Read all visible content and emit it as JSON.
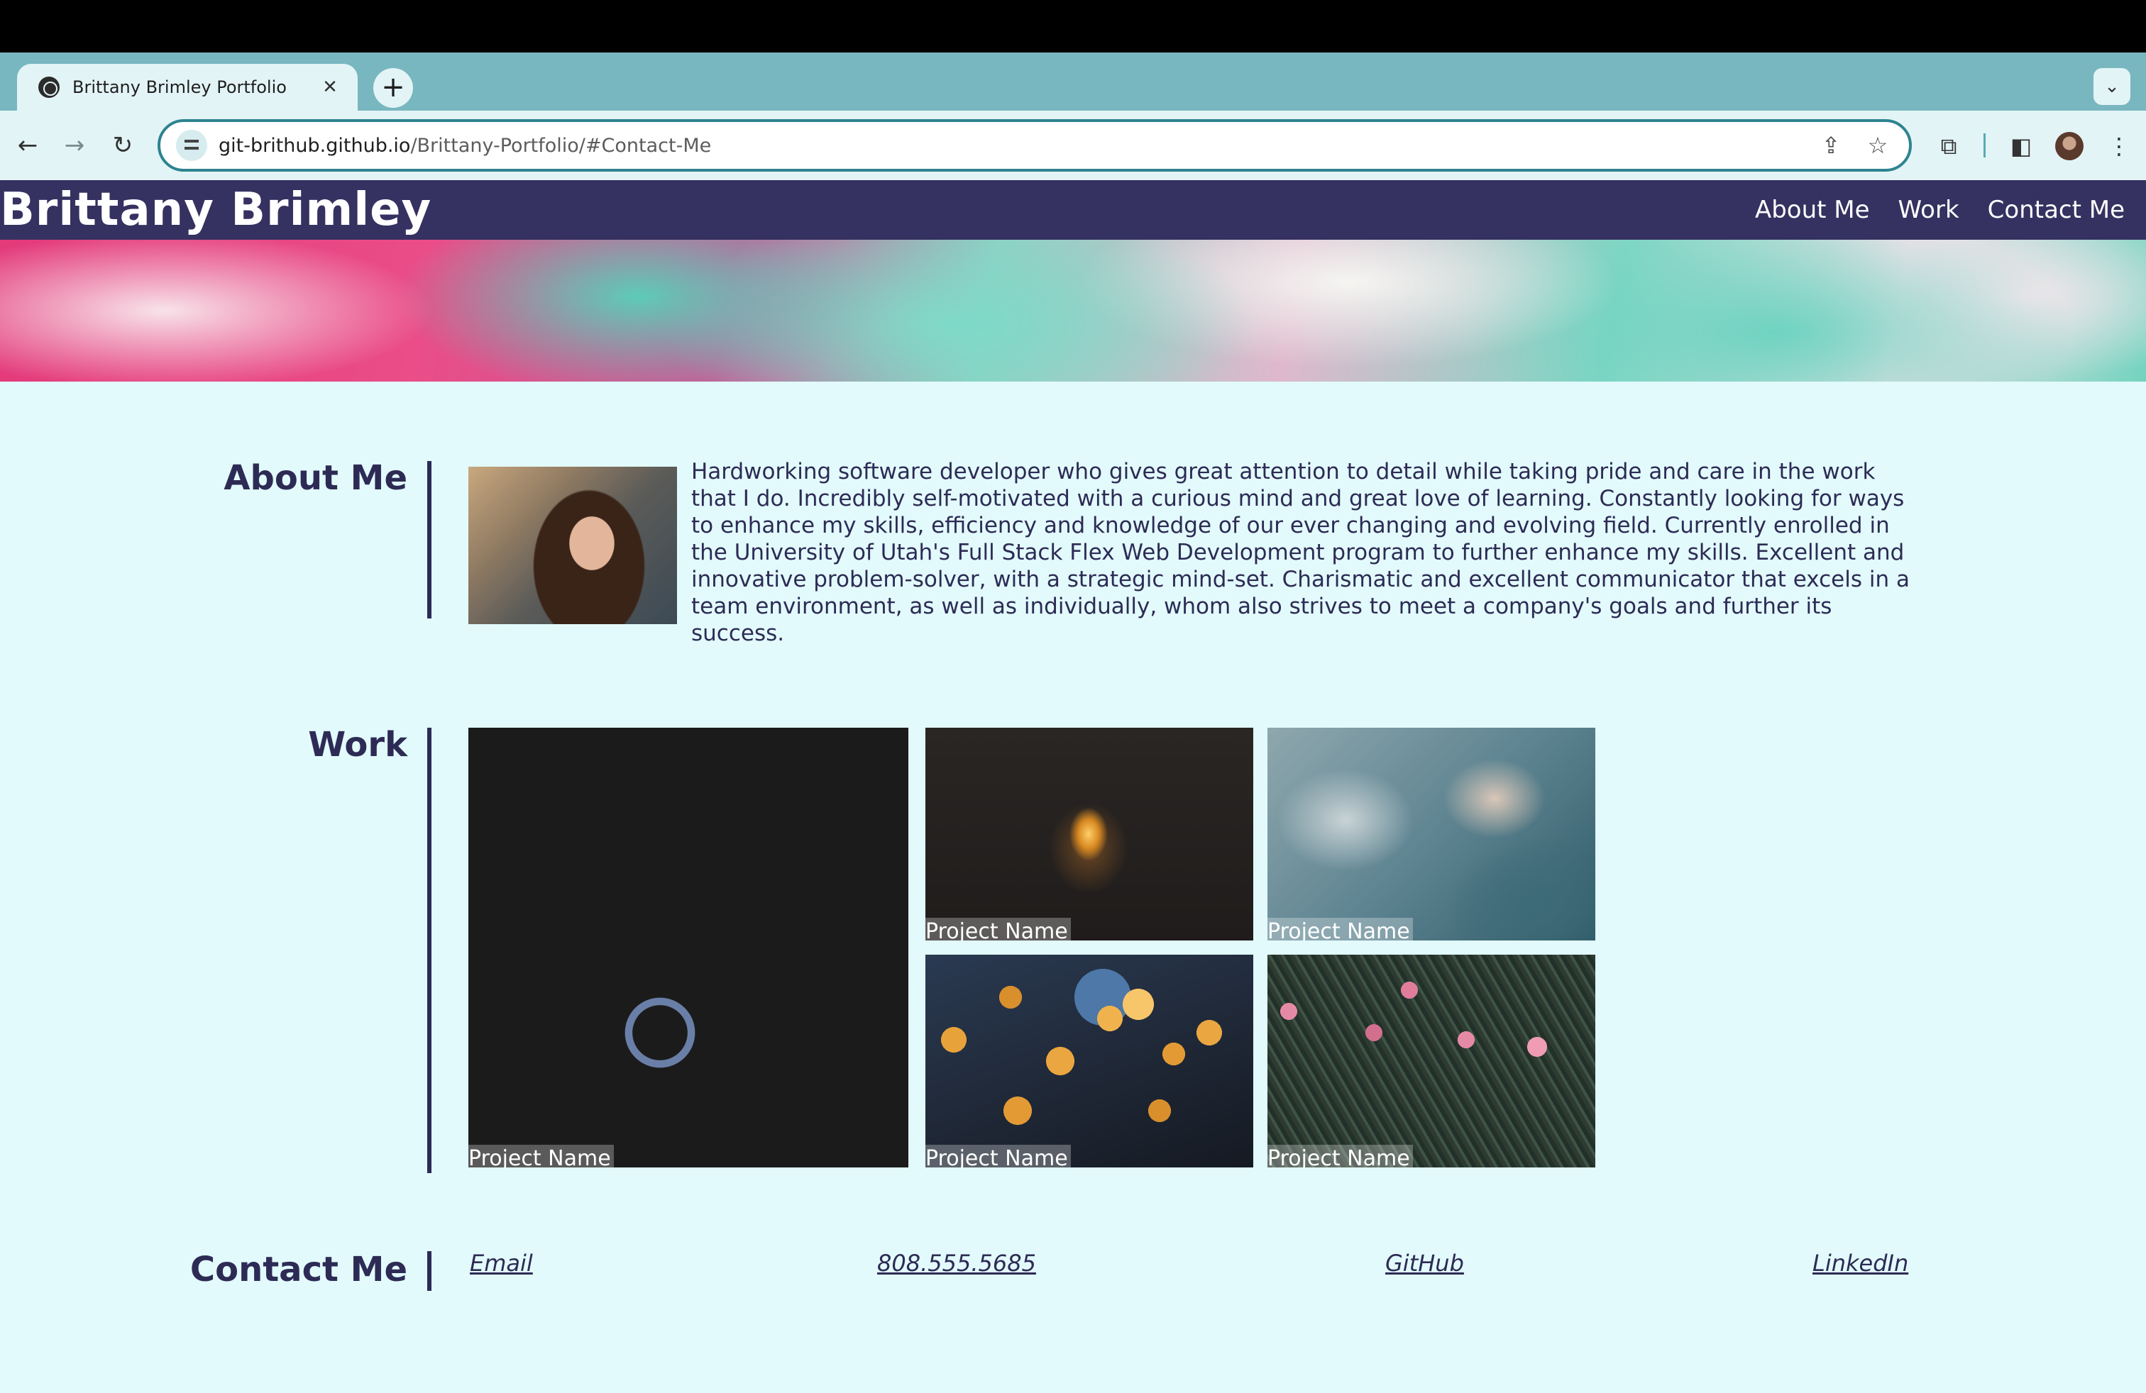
{
  "browser": {
    "tab": {
      "title": "Brittany Brimley Portfolio",
      "close": "✕",
      "favicon": "globe-icon"
    },
    "new_tab": "+",
    "tab_search": "⌄",
    "nav": {
      "back": "←",
      "forward": "→",
      "reload": "↻"
    },
    "address": {
      "host": "git-brithub.github.io",
      "path": "/Brittany-Portfolio/#Contact-Me"
    },
    "icons": {
      "share": "⇪",
      "bookmark": "☆",
      "extensions": "⧉",
      "sidepanel": "◧",
      "menu": "⋮"
    }
  },
  "site": {
    "title": "Brittany Brimley",
    "nav": [
      "About Me",
      "Work",
      "Contact Me"
    ]
  },
  "about": {
    "heading": "About Me",
    "text": "Hardworking software developer who gives great attention to detail while taking pride and care in the work that I do. Incredibly self-motivated with a curious mind and great love of learning. Constantly looking for ways to enhance my skills, efficiency and knowledge of our ever changing and evolving field. Currently enrolled in the University of Utah's Full Stack Flex Web Development program to further enhance my skills. Excellent and innovative problem-solver, with a strategic mind-set. Charismatic and excellent communicator that excels in a team environment, as well as individually, whom also strives to meet a company's goals and further its success."
  },
  "work": {
    "heading": "Work",
    "projects": [
      {
        "caption": "Project Name"
      },
      {
        "caption": "Project Name"
      },
      {
        "caption": "Project Name"
      },
      {
        "caption": "Project Name"
      },
      {
        "caption": "Project Name"
      }
    ]
  },
  "contact": {
    "heading": "Contact Me",
    "links": [
      "Email",
      "808.555.5685",
      "GitHub",
      "LinkedIn"
    ]
  }
}
